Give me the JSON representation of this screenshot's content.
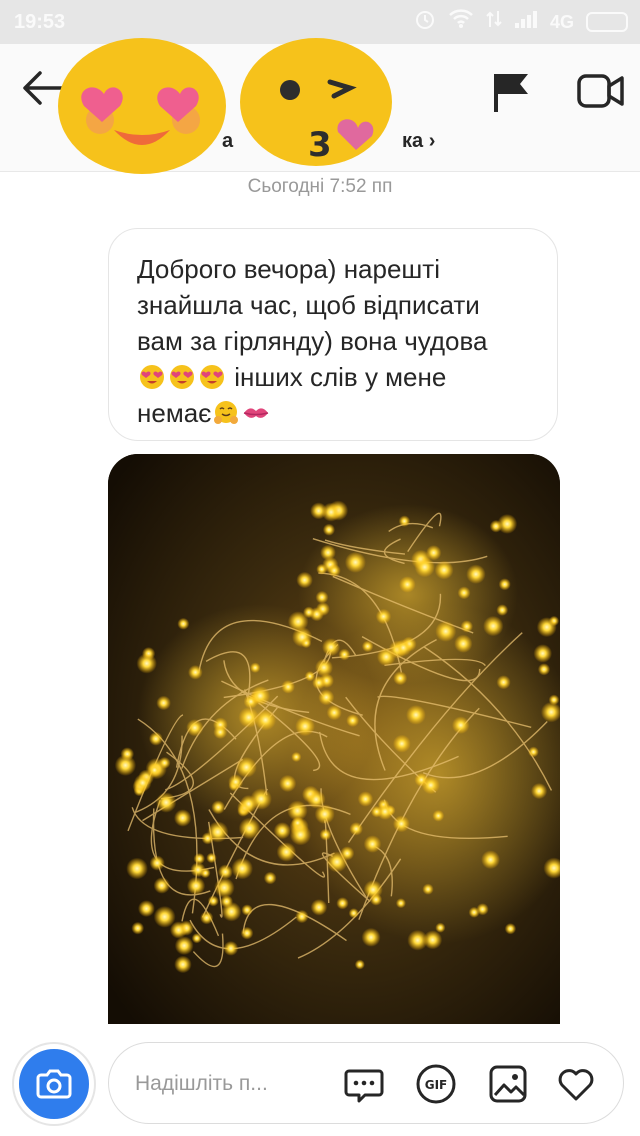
{
  "status_bar": {
    "time": "19:53",
    "network": "4G"
  },
  "header": {
    "name_visible_start": "а",
    "name_visible_end": "ка",
    "chevron": "›",
    "icons": [
      "back-arrow-icon",
      "flag-icon",
      "video-camera-icon"
    ]
  },
  "thread": {
    "timestamp": "Сьогодні 7:52 пп",
    "message": {
      "line1": "Доброго вечора) нарешті",
      "line2": "знайшла час, щоб відписати",
      "line3": "вам за гірлянду) вона чудова",
      "line4_text": " інших слів у мене",
      "line5_text": "немає"
    }
  },
  "composer": {
    "placeholder": "Надішліть п...",
    "icons": [
      "camera-icon",
      "chat-dots-icon",
      "gif-icon",
      "gallery-icon",
      "heart-icon"
    ],
    "accent": "#2f7ded"
  }
}
